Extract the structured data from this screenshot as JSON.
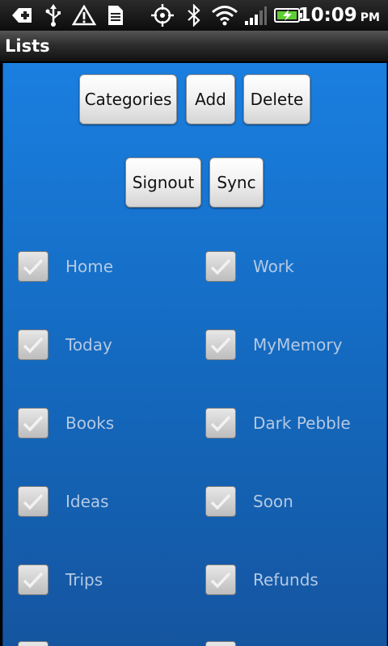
{
  "status_bar": {
    "time": "10:09",
    "ampm": "PM",
    "icons": [
      "back-arrow-icon",
      "usb-icon",
      "warning-icon",
      "sd-card-icon",
      "gps-icon",
      "bluetooth-icon",
      "wifi-icon",
      "signal-icon",
      "battery-charging-icon"
    ]
  },
  "title_bar": {
    "title": "Lists"
  },
  "toolbar": {
    "categories_label": "Categories",
    "add_label": "Add",
    "delete_label": "Delete",
    "signout_label": "Signout",
    "sync_label": "Sync"
  },
  "lists": {
    "items": [
      {
        "label": "Home",
        "checked": false
      },
      {
        "label": "Work",
        "checked": false
      },
      {
        "label": "Today",
        "checked": false
      },
      {
        "label": "MyMemory",
        "checked": false
      },
      {
        "label": "Books",
        "checked": false
      },
      {
        "label": "Dark Pebble",
        "checked": false
      },
      {
        "label": "Ideas",
        "checked": false
      },
      {
        "label": "Soon",
        "checked": false
      },
      {
        "label": "Trips",
        "checked": false
      },
      {
        "label": "Refunds",
        "checked": false
      }
    ]
  },
  "colors": {
    "background_top": "#1a7fe0",
    "background_bottom": "#1555a0",
    "item_text": "#b4c9e3",
    "button_text": "#111111"
  }
}
